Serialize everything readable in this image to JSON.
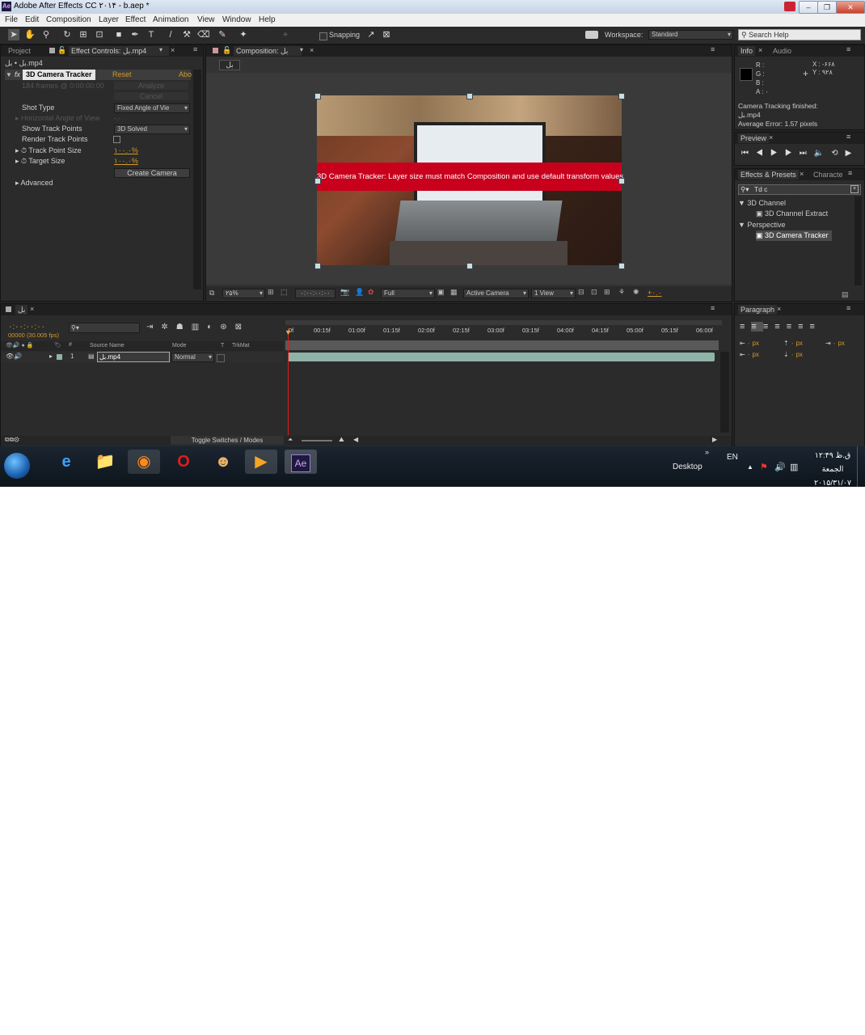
{
  "window": {
    "title": "Adobe After Effects CC ۲۰۱۴ - b.aep *"
  },
  "menu": [
    "File",
    "Edit",
    "Composition",
    "Layer",
    "Effect",
    "Animation",
    "View",
    "Window",
    "Help"
  ],
  "toolbar": {
    "snapping_label": "Snapping",
    "workspace_label": "Workspace:",
    "workspace_value": "Standard",
    "search_placeholder": "Search Help"
  },
  "effect_controls": {
    "tab_project": "Project",
    "tab_label": "Effect Controls: بل.mp4",
    "breadcrumb": "بل • بل.mp4",
    "effect_name": "3D Camera Tracker",
    "reset": "Reset",
    "about": "Abo",
    "frames_info": "184 frames @ 0:00:00:00",
    "analyze": "Analyze",
    "cancel": "Cancel",
    "props": [
      {
        "label": "Shot Type",
        "value": "Fixed Angle of Vie"
      },
      {
        "label": "Horizontal Angle of View",
        "value": "-.-"
      },
      {
        "label": "Show Track Points",
        "value": "3D Solved"
      },
      {
        "label": "Render Track Points",
        "value": ""
      },
      {
        "label": "Track Point Size",
        "value": "۱۰۰.۰%"
      },
      {
        "label": "Target Size",
        "value": "۱۰۰.۰%"
      }
    ],
    "create_camera": "Create Camera",
    "advanced": "Advanced"
  },
  "composition": {
    "tab_label": "Composition: بل",
    "subtab": "بل",
    "warning": "3D Camera Tracker: Layer size must match Composition and use default transform values",
    "zoom": "۲۵%",
    "timecode": "۰:۰۰:۰۰:۰۰",
    "resolution": "Full",
    "camera": "Active Camera",
    "views": "1 View",
    "exposure": "+۰.۰"
  },
  "info": {
    "tab_info": "Info",
    "tab_audio": "Audio",
    "r": "R :",
    "g": "G :",
    "b": "B :",
    "a": "A : ۰",
    "x": "X : -۶۶۸",
    "y": "Y : ۹۲۸",
    "msg1": "Camera Tracking finished:",
    "msg2": "بل.mp4",
    "msg3": "Average Error: 1.57 pixels"
  },
  "preview": {
    "tab": "Preview"
  },
  "effects": {
    "tab": "Effects & Presets",
    "tab2": "Characte",
    "search_value": "Td c",
    "tree": [
      {
        "label": "3D Channel",
        "type": "folder"
      },
      {
        "label": "3D Channel Extract",
        "type": "item"
      },
      {
        "label": "Perspective",
        "type": "folder"
      },
      {
        "label": "3D Camera Tracker",
        "type": "item-selected"
      }
    ]
  },
  "timeline": {
    "tab": "بل",
    "timecode": "۰:۰۰:۰۰:۰۰",
    "fps": "00000 (30.005 fps)",
    "col_source": "Source Name",
    "col_mode": "Mode",
    "col_t": "T",
    "col_trkmat": "TrkMat",
    "col_num": "#",
    "layer_num": "1",
    "layer_name": "بل.mp4",
    "layer_mode": "Normal",
    "ticks": [
      "0f",
      "00:15f",
      "01:00f",
      "01:15f",
      "02:00f",
      "02:15f",
      "03:00f",
      "03:15f",
      "04:00f",
      "04:15f",
      "05:00f",
      "05:15f",
      "06:00f"
    ],
    "toggle_label": "Toggle Switches / Modes"
  },
  "paragraph": {
    "tab": "Paragraph",
    "px1": "۰ px",
    "px2": "۰ px",
    "px3": "۰ px",
    "px4": "۰ px",
    "px5": "۰ px"
  },
  "taskbar": {
    "desktop": "Desktop",
    "lang": "EN",
    "time": "ق.ظ ۱۲:۴۹",
    "day": "الجمعة",
    "date": "۲۰۱۵/۳۱/۰۷"
  },
  "colors": {
    "accent_orange": "#d39a2a",
    "warning_red": "#c8001c",
    "layer_bar": "#8fb3a9"
  }
}
